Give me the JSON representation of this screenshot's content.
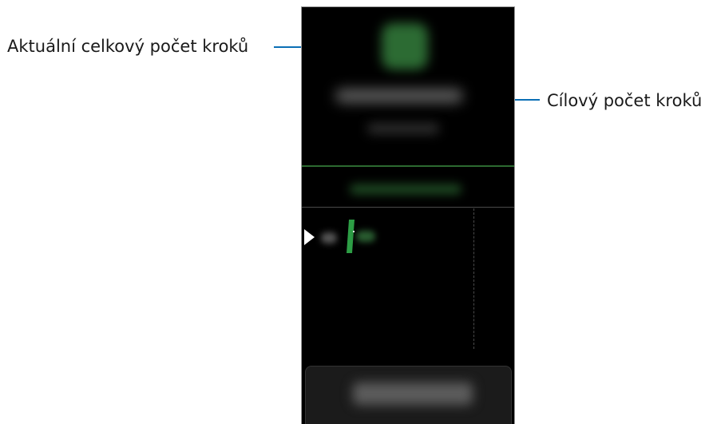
{
  "callouts": {
    "left_label": "Aktuální celkový počet kroků",
    "right_label": "Cílový počet kroků"
  },
  "colors": {
    "leader_line": "#0b6fb5",
    "screen_background": "#000000",
    "goal_line": "#2c6a30",
    "activity_bar": "#2d9e45"
  },
  "device": {
    "icons": {
      "step_icon": "steps-icon",
      "play_icon": "play-icon"
    }
  }
}
